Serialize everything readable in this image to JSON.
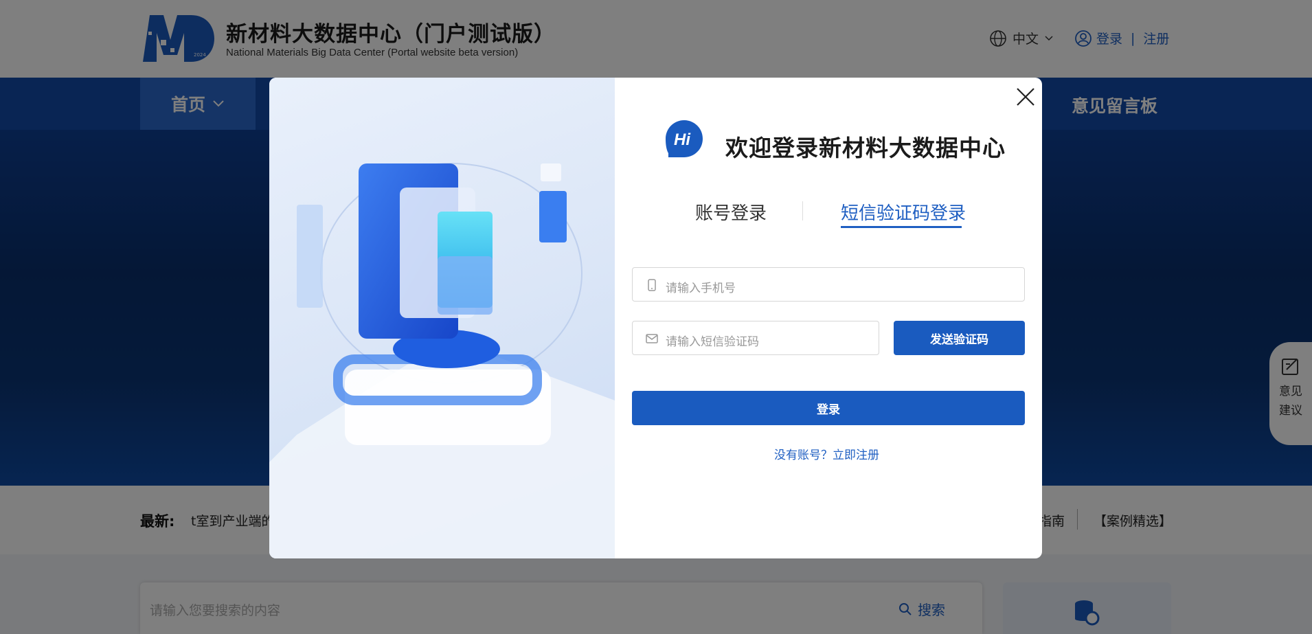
{
  "header": {
    "brand_title": "新材料大数据中心（门户测试版）",
    "brand_subtitle": "National Materials Big Data Center (Portal website beta version)",
    "logo_year": "2024",
    "language": "中文",
    "login": "登录",
    "separator": "|",
    "register": "注册"
  },
  "nav": {
    "home": "首页",
    "message_board": "意见留言板"
  },
  "news": {
    "label": "最新:",
    "ticker": "t室到产业端的",
    "right_item_1": "指南",
    "right_item_2": "【案例精选】"
  },
  "search": {
    "placeholder": "请输入您要搜索的内容",
    "button": "搜索"
  },
  "feedback": {
    "label": "意见建议"
  },
  "modal": {
    "hi": "Hi",
    "welcome": "欢迎登录新材料大数据中心",
    "tab_account": "账号登录",
    "tab_sms": "短信验证码登录",
    "phone_placeholder": "请输入手机号",
    "code_placeholder": "请输入短信验证码",
    "send_code": "发送验证码",
    "login": "登录",
    "register_link": "没有账号？立即注册"
  },
  "colors": {
    "accent": "#1a5bbf",
    "nav": "#124ba8",
    "overlay": "rgba(0,0,0,0.5)"
  }
}
